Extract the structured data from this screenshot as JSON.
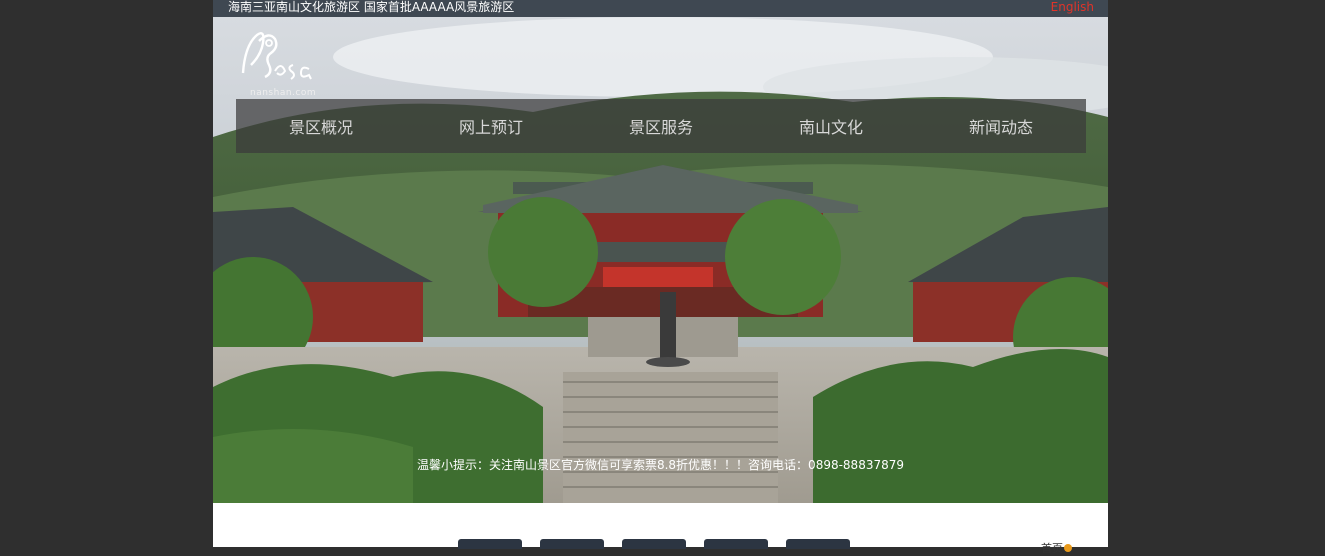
{
  "topbar": {
    "slogan": "海南三亚南山文化旅游区 国家首批AAAAA风景旅游区",
    "language_link": "English"
  },
  "logo": {
    "site": "nanshan.com"
  },
  "nav": {
    "items": [
      {
        "label": "景区概况"
      },
      {
        "label": "网上预订"
      },
      {
        "label": "景区服务"
      },
      {
        "label": "南山文化"
      },
      {
        "label": "新闻动态"
      }
    ]
  },
  "notice": {
    "text": "温馨小提示：关注南山景区官方微信可享索票8.8折优惠！！！咨询电话：0898-88837879"
  },
  "content": {
    "home_link": "首页"
  },
  "colors": {
    "topbar_bg": "#3f4852",
    "language_link": "#e0342a",
    "page_bg": "#2f2f2f",
    "tile_bg": "#2c3542"
  }
}
